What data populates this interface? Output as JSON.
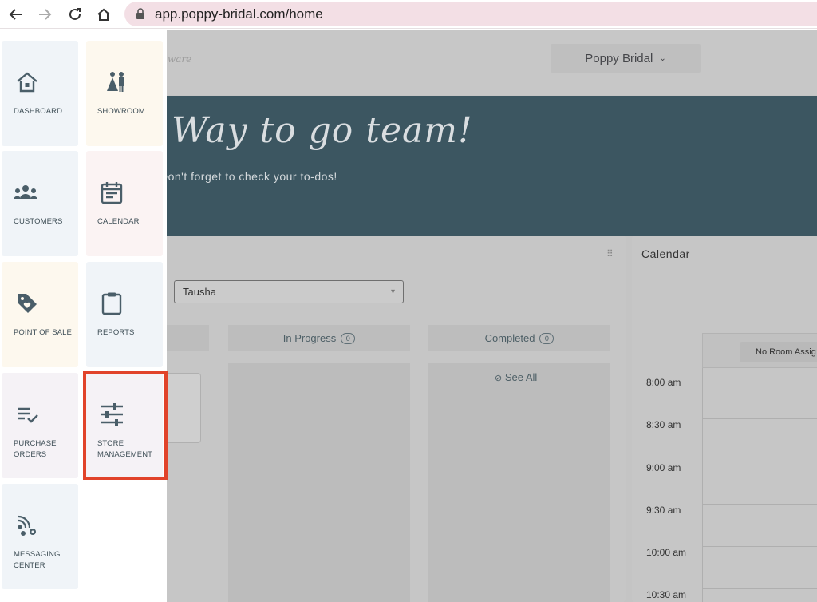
{
  "browser": {
    "url": "app.poppy-bridal.com/home"
  },
  "header": {
    "logo_fragment": "ware",
    "store_name": "Poppy Bridal"
  },
  "banner": {
    "title": "Way to go team!",
    "subtitle": "Don't forget to check your to-dos!"
  },
  "todos": {
    "assignee": "Tausha",
    "columns": [
      {
        "label": "In Progress",
        "count": "0"
      },
      {
        "label": "Completed",
        "count": "0"
      }
    ],
    "see_all": "See All"
  },
  "calendar": {
    "title": "Calendar",
    "room": "No Room Assig",
    "times": [
      "8:00 am",
      "8:30 am",
      "9:00 am",
      "9:30 am",
      "10:00 am",
      "10:30 am"
    ]
  },
  "menu": {
    "items": [
      {
        "label": "DASHBOARD",
        "icon": "home-icon"
      },
      {
        "label": "SHOWROOM",
        "icon": "bride-groom-icon"
      },
      {
        "label": "CUSTOMERS",
        "icon": "people-icon"
      },
      {
        "label": "CALENDAR",
        "icon": "calendar-icon"
      },
      {
        "label": "POINT OF SALE",
        "icon": "price-tag-icon"
      },
      {
        "label": "REPORTS",
        "icon": "clipboard-icon"
      },
      {
        "label": "PURCHASE ORDERS",
        "icon": "list-check-icon"
      },
      {
        "label": "STORE MANAGEMENT",
        "icon": "sliders-icon"
      },
      {
        "label": "MESSAGING CENTER",
        "icon": "broadcast-icon"
      }
    ],
    "highlighted": "STORE MANAGEMENT"
  },
  "colors": {
    "banner": "#3c5661",
    "highlight": "#e1432a",
    "icon": "#4a5e69"
  }
}
